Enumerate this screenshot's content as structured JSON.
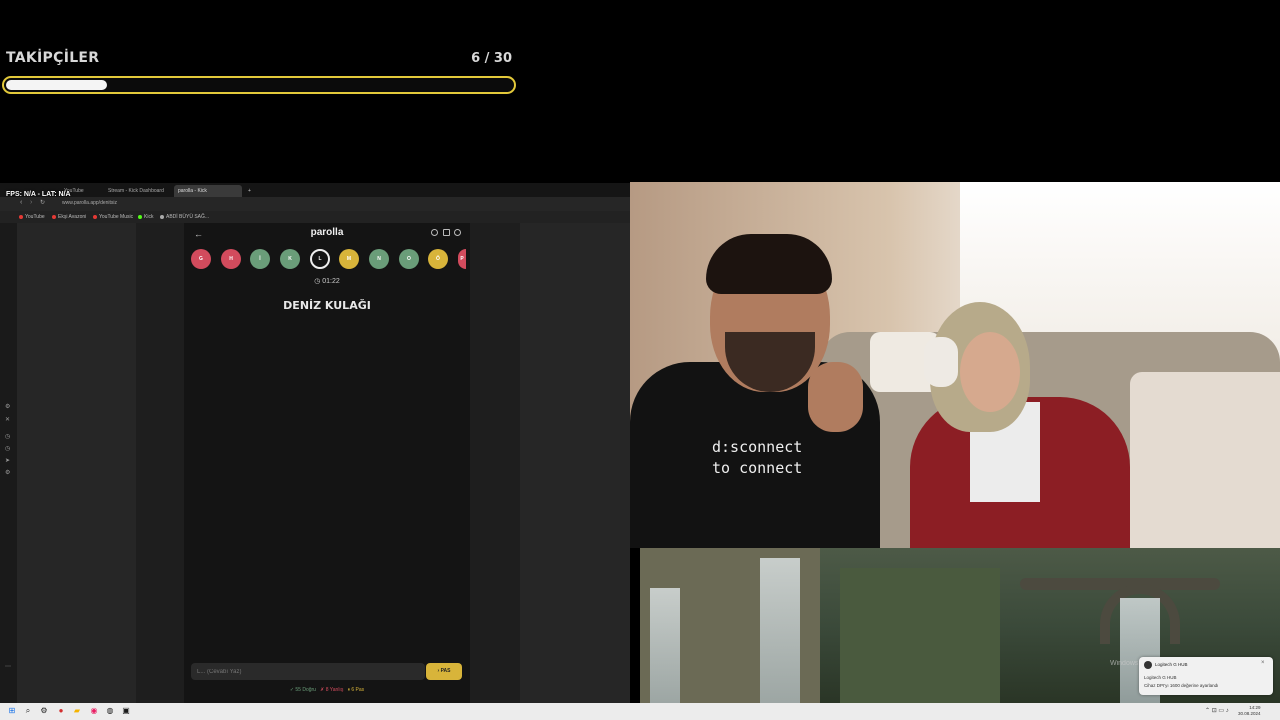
{
  "goal": {
    "title": "TAKİPÇİLER",
    "current": "6",
    "separator": "/",
    "target": "30",
    "count_text": "6 / 30",
    "progress_fraction": 0.2,
    "bar_color": "#e3c93a"
  },
  "browser": {
    "fps_text": "FPS: N/A - LAT: N/A",
    "tabs": [
      {
        "label": "YouTube",
        "active": false
      },
      {
        "label": "Stream - Kick Dashboard",
        "active": false
      },
      {
        "label": "parolla - Kick",
        "active": true
      }
    ],
    "url": "www.parolla.app/denitsiz",
    "bookmarks": [
      {
        "label": "YouTube",
        "color": "#e53935"
      },
      {
        "label": "Ekşi Avazoni",
        "color": "#e53935"
      },
      {
        "label": "YouTube Music",
        "color": "#e53935"
      },
      {
        "label": "Kick",
        "color": "#53fc18"
      },
      {
        "label": "ABDİ BÜYÜ SAĞ...",
        "color": "#aaaaaa"
      }
    ]
  },
  "game": {
    "title": "parolla",
    "letters": [
      {
        "char": "G",
        "state": "red"
      },
      {
        "char": "H",
        "state": "red"
      },
      {
        "char": "İ",
        "state": "green"
      },
      {
        "char": "K",
        "state": "green"
      },
      {
        "char": "L",
        "state": "current"
      },
      {
        "char": "M",
        "state": "yellow"
      },
      {
        "char": "N",
        "state": "green"
      },
      {
        "char": "O",
        "state": "green"
      },
      {
        "char": "Ö",
        "state": "yellow"
      },
      {
        "char": "P",
        "state": "red"
      }
    ],
    "timer": "01:22",
    "question": "DENİZ KULAĞI",
    "input_placeholder": "L... (Cevabı Yaz)",
    "pass_label": "PAS",
    "score": {
      "correct": "✓ 55 Doğru",
      "wrong": "✗ 8 Yanlış",
      "pass": "⏸ 6 Pas"
    }
  },
  "webcam": {
    "shirt_line1": "d:sconnect",
    "shirt_line2": "to connect"
  },
  "desktop": {
    "watermark": "Windows",
    "toast": {
      "title": "Logitech G HUB",
      "line1": "Logitech G HUB",
      "line2": "Cihaz DPI'yı 1600 değerine ayarlandı"
    },
    "clock_time": "14:29",
    "clock_date": "30.08.2024"
  },
  "colors": {
    "red": "#d24b5d",
    "green": "#6a9d79",
    "yellow": "#d8b43a"
  }
}
